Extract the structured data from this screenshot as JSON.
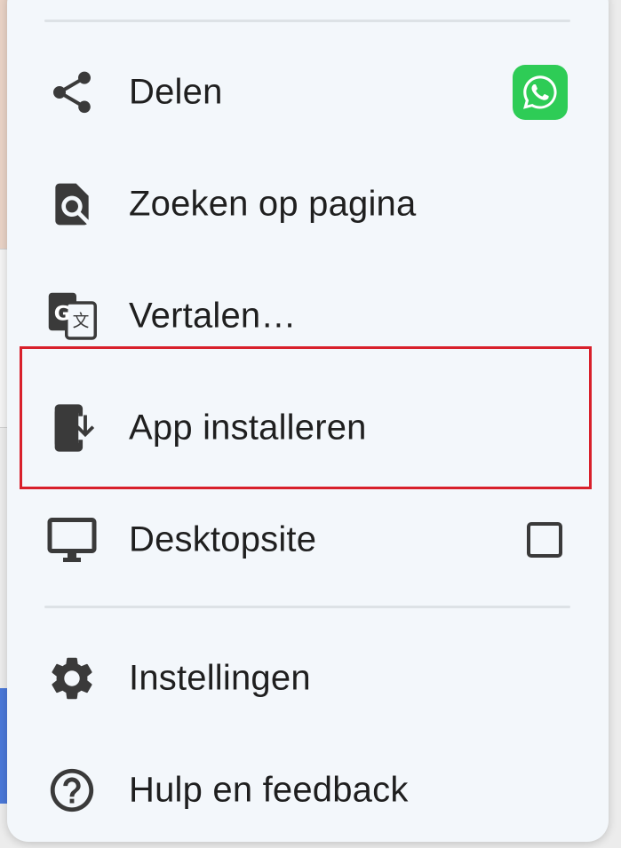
{
  "menu": {
    "items": [
      {
        "id": "share",
        "label": "Delen",
        "icon": "share-icon"
      },
      {
        "id": "find",
        "label": "Zoeken op pagina",
        "icon": "find-in-page-icon"
      },
      {
        "id": "translate",
        "label": "Vertalen…",
        "icon": "translate-icon"
      },
      {
        "id": "install",
        "label": "App installeren",
        "icon": "install-app-icon"
      },
      {
        "id": "desktop",
        "label": "Desktopsite",
        "icon": "desktop-icon"
      },
      {
        "id": "settings",
        "label": "Instellingen",
        "icon": "gear-icon"
      },
      {
        "id": "help",
        "label": "Hulp en feedback",
        "icon": "help-icon"
      }
    ],
    "share_target_icon": "whatsapp-icon",
    "desktop_site_checked": false,
    "highlighted_item": "install"
  },
  "colors": {
    "menu_background": "#f3f7fb",
    "text": "#1f1f1f",
    "icon": "#3a3a3a",
    "whatsapp": "#2ecc56",
    "highlight_border": "#d8202b",
    "divider": "#dde2e6"
  }
}
